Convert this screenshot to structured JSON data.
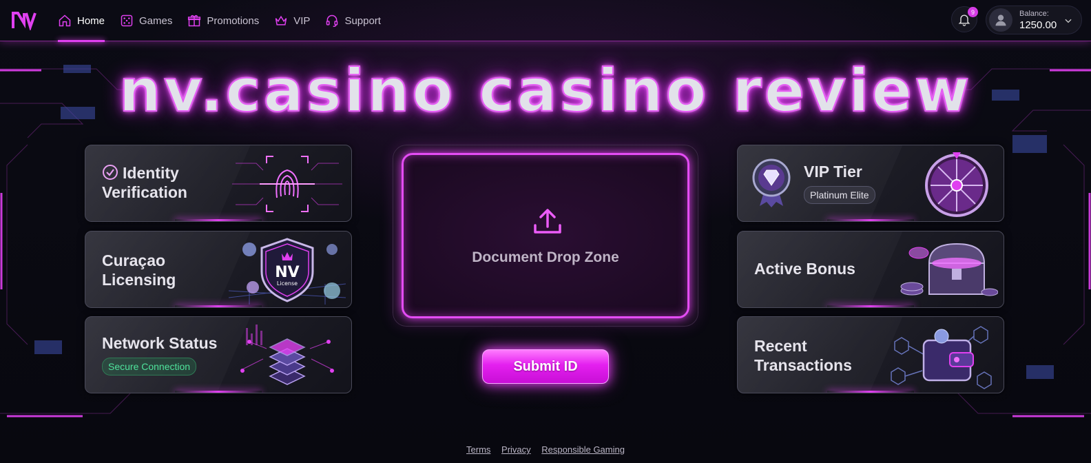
{
  "nav": {
    "items": [
      {
        "label": "Home",
        "icon": "home-icon",
        "active": true
      },
      {
        "label": "Games",
        "icon": "dice-icon"
      },
      {
        "label": "Promotions",
        "icon": "gift-icon"
      },
      {
        "label": "VIP",
        "icon": "crown-icon"
      },
      {
        "label": "Support",
        "icon": "headset-icon"
      }
    ],
    "notifications_count": "9",
    "balance_label": "Balance:",
    "balance_value": "1250.00"
  },
  "hero": {
    "title": "nv.casino casino review"
  },
  "left_cards": [
    {
      "title_line1": "Identity",
      "title_line2": "Verification",
      "icon": "fingerprint-icon"
    },
    {
      "title_line1": "Curaçao",
      "title_line2": "Licensing",
      "badge_text": "NV",
      "badge_sub": "License",
      "icon": "shield-icon"
    },
    {
      "title": "Network Status",
      "status": "Secure Connection",
      "icon": "server-icon"
    }
  ],
  "center": {
    "drop_label": "Document Drop Zone",
    "submit_label": "Submit ID"
  },
  "right_cards": [
    {
      "title": "VIP Tier",
      "tier": "Platinum Elite",
      "icon": "wheel-icon"
    },
    {
      "title": "Active Bonus",
      "icon": "treasure-chest-icon"
    },
    {
      "title_line1": "Recent",
      "title_line2": "Transactions",
      "icon": "wallet-icon"
    }
  ],
  "footer": {
    "links": [
      "Terms",
      "Privacy",
      "Responsible Gaming"
    ]
  },
  "colors": {
    "accent": "#e040f0",
    "background": "#0a0a12",
    "success": "#4fe39c"
  }
}
